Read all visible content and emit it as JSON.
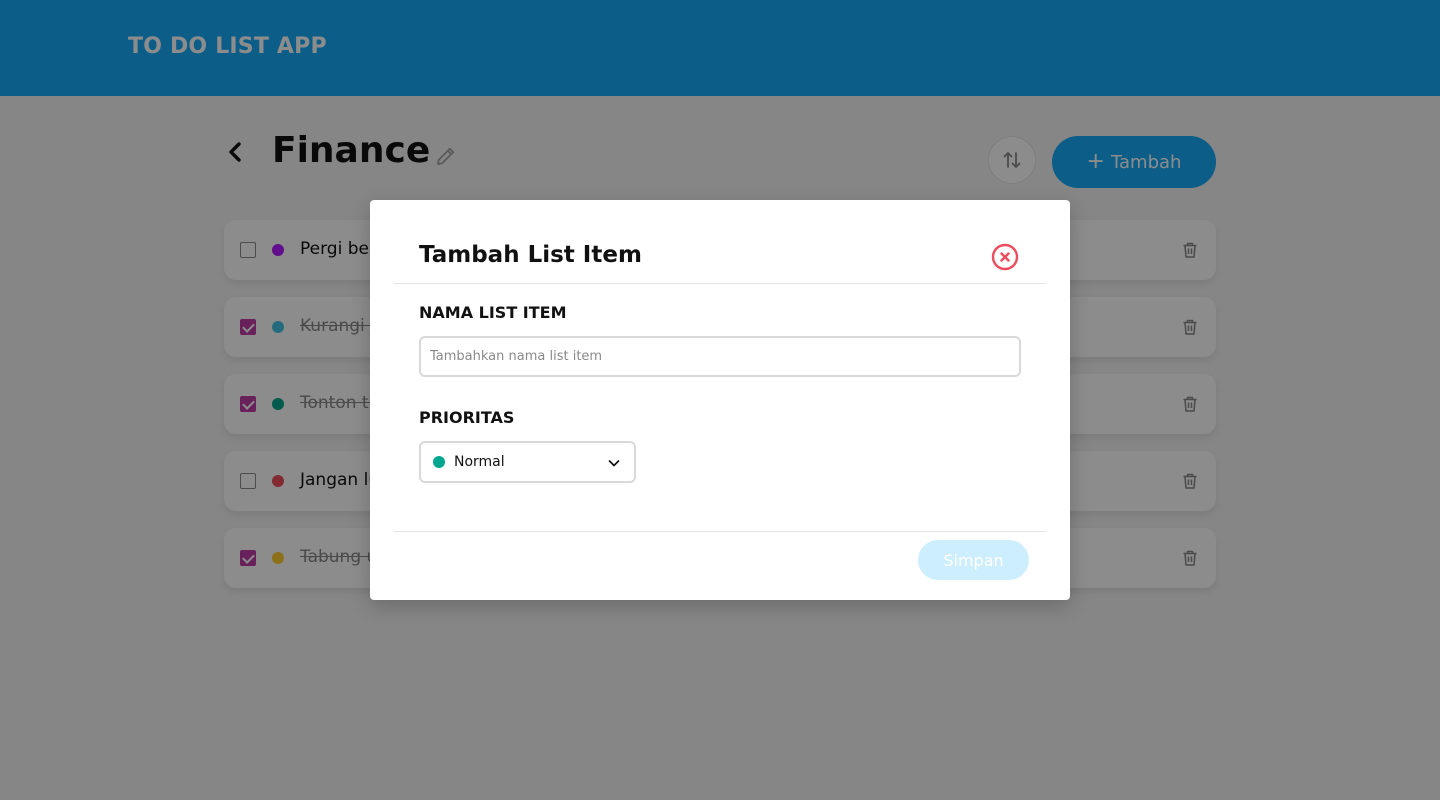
{
  "app": {
    "title": "TO DO LIST APP"
  },
  "activity": {
    "title": "Finance",
    "add_button_label": "Tambah",
    "add_button_icon": "+"
  },
  "todo_items": [
    {
      "label": "Pergi belanja bulanan",
      "checked": false,
      "done": false,
      "priority_color": "#b01aff"
    },
    {
      "label": "Kurangi jajan di luar",
      "checked": true,
      "done": true,
      "priority_color": "#43c4e3"
    },
    {
      "label": "Tonton tutorial investasi",
      "checked": true,
      "done": true,
      "priority_color": "#00a790"
    },
    {
      "label": "Jangan lupa bayar tagihan",
      "checked": false,
      "done": false,
      "priority_color": "#ed4c5c"
    },
    {
      "label": "Tabung uang sisa gaji",
      "checked": true,
      "done": true,
      "priority_color": "#ffce31"
    }
  ],
  "modal": {
    "title": "Tambah List Item",
    "name_label": "NAMA LIST ITEM",
    "name_placeholder": "Tambahkan nama list item",
    "name_value": "",
    "priority_label": "PRIORITAS",
    "priority_selected": "Normal",
    "priority_color": "#00a790",
    "save_label": "Simpan"
  },
  "colors": {
    "primary": "#16abf8",
    "close_icon": "#ed4c5c",
    "checked_box": "#c03ca6"
  },
  "icons": {
    "back": "chevron-left-icon",
    "edit": "pencil-icon",
    "sort": "sort-arrows-icon",
    "delete": "trash-icon",
    "close": "close-circle-icon",
    "dropdown": "chevron-down-icon"
  }
}
